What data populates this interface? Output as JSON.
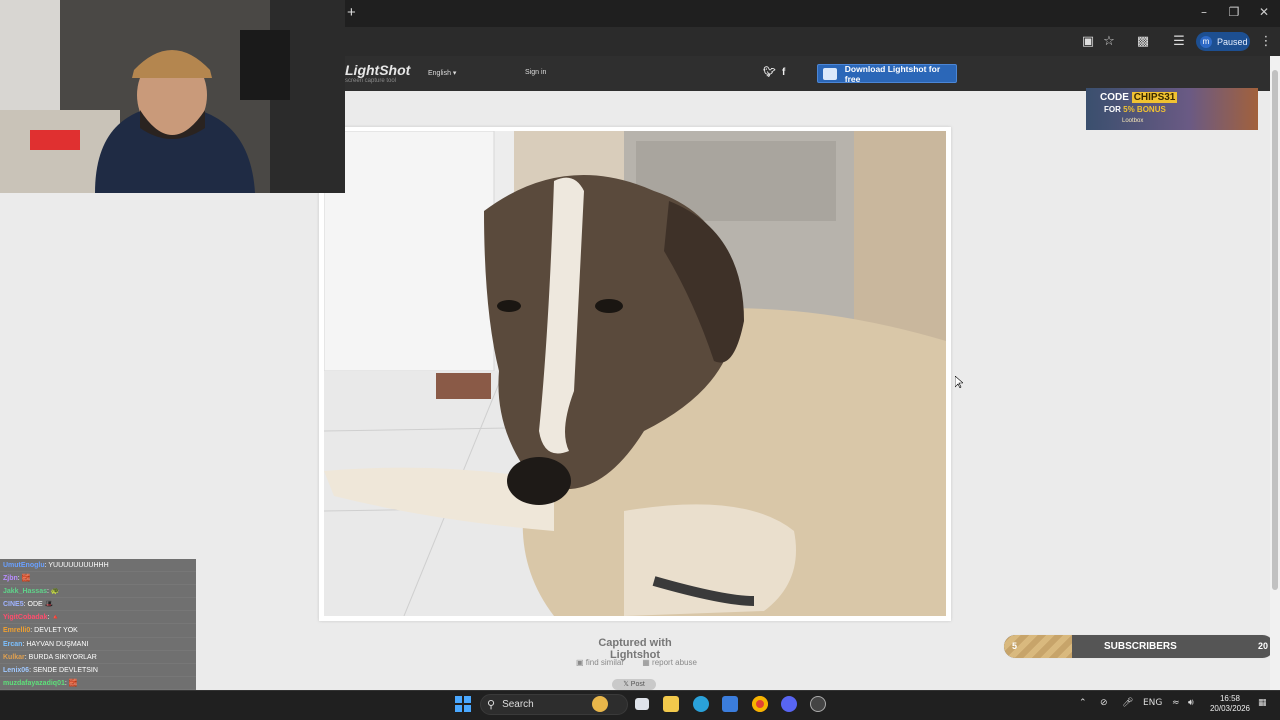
{
  "browser": {
    "new_tab": "+",
    "profile_initial": "m",
    "profile_status": "Paused"
  },
  "lightshot": {
    "logo": "LightShot",
    "tagline": "screen capture tool",
    "language": "English",
    "sign_in": "Sign in",
    "twitter_icon": "twitter-icon",
    "facebook_icon": "facebook-icon",
    "download_label": "Download Lightshot for free",
    "captured_label": "Captured with Lightshot",
    "find_similar": "find similar",
    "report_abuse": "report abuse",
    "post_label": "Post"
  },
  "ad": {
    "code_prefix": "CODE",
    "code_value": "CHIPS31",
    "bonus_prefix": "FOR",
    "bonus_value": "5% BONUS",
    "brand": "Lootbox"
  },
  "subscribers": {
    "current": "5",
    "label": "SUBSCRIBERS",
    "goal": "20",
    "progress_fraction": 0.25
  },
  "chat": [
    {
      "user": "UmutEnoglu",
      "user_color": "#6aa0ff",
      "message": ": YUUUUUUUUHHH"
    },
    {
      "user": "Zjbn",
      "user_color": "#b98cff",
      "message": ": 🧱"
    },
    {
      "user": "Jakk_Hassas",
      "user_color": "#5fd38a",
      "message": ": 🐢"
    },
    {
      "user": "CINE5",
      "user_color": "#9fb2ff",
      "message": ": ODE 🎩"
    },
    {
      "user": "YigitCobadak",
      "user_color": "#ff4d6d",
      "message": ": 🔺"
    },
    {
      "user": "Emrelli0",
      "user_color": "#f0a030",
      "message": ": DEVLET YOK"
    },
    {
      "user": "Ercan",
      "user_color": "#7cc0ff",
      "message": ": HAYVAN DUŞMANI"
    },
    {
      "user": "Kulkar",
      "user_color": "#e0a050",
      "message": ": BURDA SIKIYORLAR"
    },
    {
      "user": "Lenix06",
      "user_color": "#a0c8ff",
      "message": ": SENDE DEVLETSIN"
    },
    {
      "user": "muzdafayazadiq01",
      "user_color": "#5ee07a",
      "message": ": 🧱"
    },
    {
      "user": "salih368",
      "user_color": "#ff5050",
      "message": ": 🧱"
    }
  ],
  "taskbar": {
    "search_label": "Search",
    "language": "ENG",
    "time": "16:58",
    "date": "20/03/2026"
  }
}
